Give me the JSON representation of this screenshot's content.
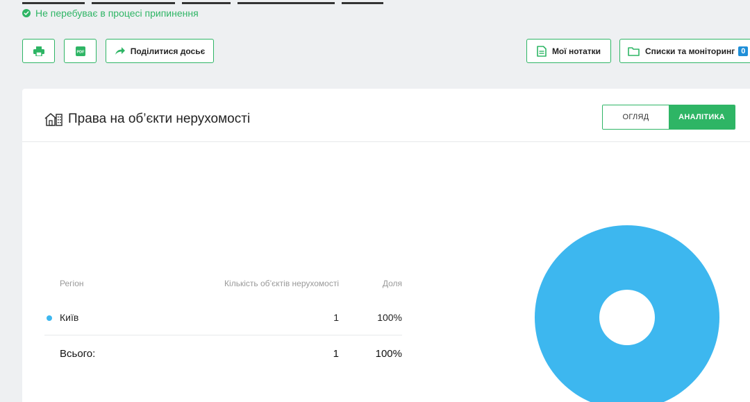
{
  "status": {
    "text": "Не перебуває в процесі припинення",
    "color": "#2eb565"
  },
  "toolbar": {
    "print_icon": "printer-icon",
    "pdf_icon": "pdf-icon",
    "pdf_icon_text": "PDF",
    "share_label": "Поділитися досьє",
    "notes_label": "Мої нотатки",
    "lists_label": "Списки та моніторинг",
    "lists_count": "0"
  },
  "card": {
    "title": "Права на об’єкти нерухомості",
    "tabs": [
      {
        "label": "ОГЛЯД",
        "active": false
      },
      {
        "label": "АНАЛІТИКА",
        "active": true
      }
    ]
  },
  "table": {
    "headers": {
      "region": "Регіон",
      "count": "Кількість об’єктів нерухомості",
      "share": "Доля"
    },
    "rows": [
      {
        "region": "Київ",
        "count": "1",
        "share": "100%",
        "color": "#3db7ef"
      }
    ],
    "total": {
      "label": "Всього:",
      "count": "1",
      "share": "100%"
    }
  },
  "chart_data": {
    "type": "pie",
    "categories": [
      "Київ"
    ],
    "values": [
      1
    ],
    "colors": [
      "#3db7ef"
    ],
    "donut": true
  },
  "colors": {
    "accent": "#2eb565",
    "chart": "#3db7ef",
    "badge": "#1f8fd8"
  }
}
